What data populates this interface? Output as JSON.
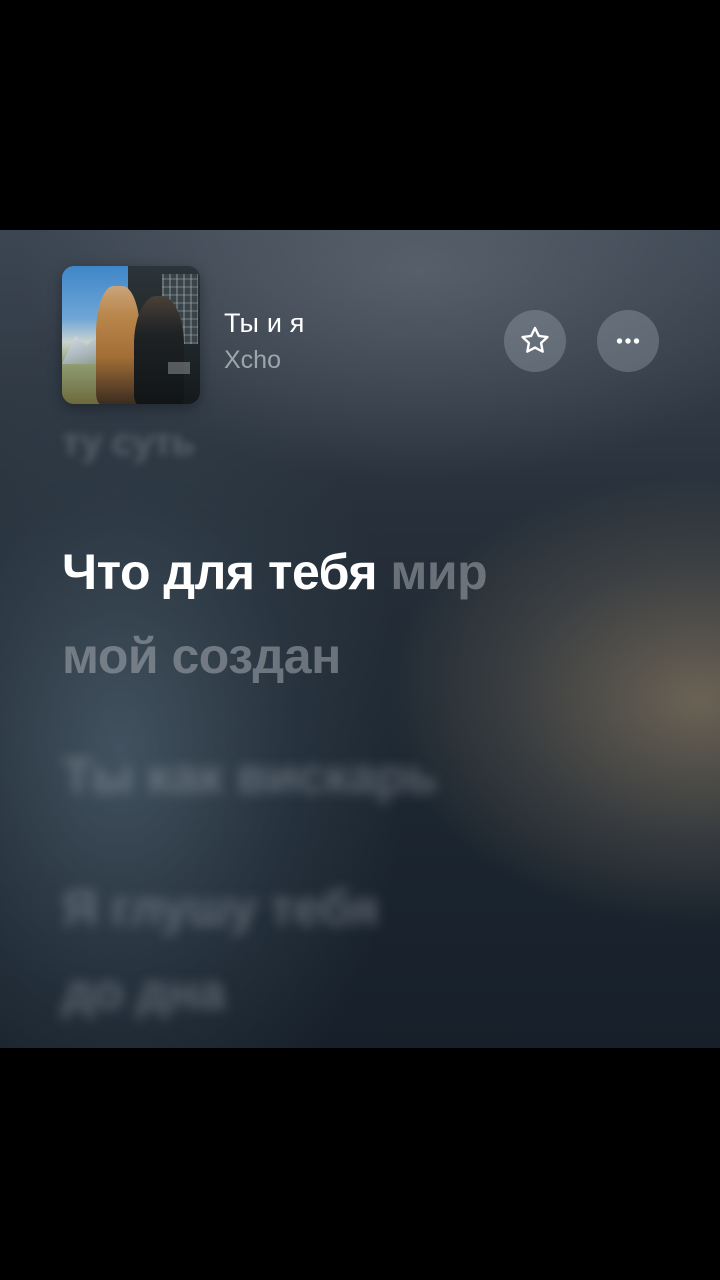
{
  "track": {
    "title": "Ты и я",
    "artist": "Xcho"
  },
  "actions": {
    "favorite_icon": "star-outline-icon",
    "more_icon": "more-dots-icon"
  },
  "lyrics": {
    "previous": "ту суть",
    "current": {
      "sung": "Что для тебя",
      "unsung_line1": " мир",
      "unsung_line2": "мой создан"
    },
    "next": [
      {
        "line1": "Ты как вискарь",
        "line2": ""
      },
      {
        "line1": "Я глушу тебя",
        "line2": "до дна"
      }
    ]
  },
  "colors": {
    "highlight": "#ffffff",
    "dim": "#aeb4b9",
    "button_bg": "#8e99a3"
  }
}
